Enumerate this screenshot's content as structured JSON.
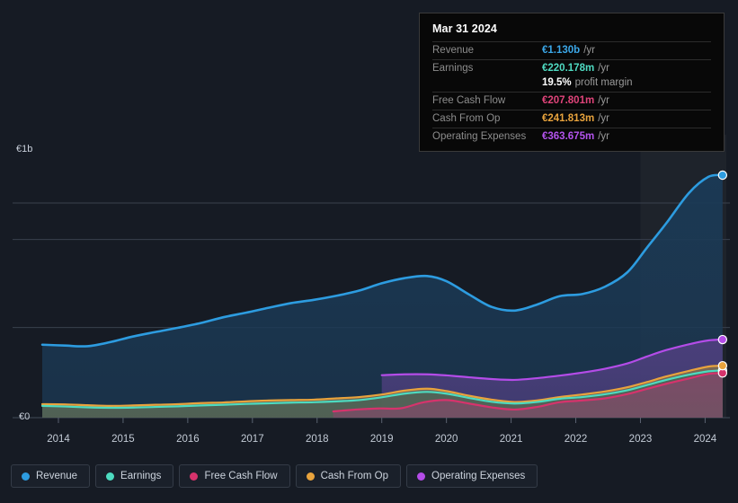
{
  "tooltip": {
    "title": "Mar 31 2024",
    "rows": [
      {
        "label": "Revenue",
        "value": "€1.130b",
        "suffix": "/yr",
        "color": "#3ba7e8"
      },
      {
        "label": "Earnings",
        "value": "€220.178m",
        "suffix": "/yr",
        "color": "#4fdbc2"
      },
      {
        "label": "",
        "value": "19.5%",
        "suffix": "profit margin",
        "color": "#ffffff"
      },
      {
        "label": "Free Cash Flow",
        "value": "€207.801m",
        "suffix": "/yr",
        "color": "#e0447a"
      },
      {
        "label": "Cash From Op",
        "value": "€241.813m",
        "suffix": "/yr",
        "color": "#e8a33d"
      },
      {
        "label": "Operating Expenses",
        "value": "€363.675m",
        "suffix": "/yr",
        "color": "#b454ee"
      }
    ]
  },
  "legend": [
    {
      "label": "Revenue",
      "color": "#2d9ce0"
    },
    {
      "label": "Earnings",
      "color": "#4ddbc0"
    },
    {
      "label": "Free Cash Flow",
      "color": "#d6336c"
    },
    {
      "label": "Cash From Op",
      "color": "#e8a33d"
    },
    {
      "label": "Operating Expenses",
      "color": "#b44ce8"
    }
  ],
  "chart_data": {
    "type": "area",
    "title": "",
    "xlabel": "",
    "ylabel": "",
    "ylim": [
      0,
      1150
    ],
    "y_unit": "EUR",
    "y_ticks": [
      {
        "label": "€1b",
        "value": 1000
      },
      {
        "label": "€0",
        "value": 0
      }
    ],
    "gridlines": [
      1000,
      830,
      420
    ],
    "x_ticks": [
      "2014",
      "2015",
      "2016",
      "2017",
      "2018",
      "2019",
      "2020",
      "2021",
      "2022",
      "2023",
      "2024"
    ],
    "x_range": [
      2013.75,
      2024.3
    ],
    "forecast_start": "2023.0",
    "series": [
      {
        "name": "Revenue",
        "color": "#2d9ce0",
        "fill": "#1b3a56",
        "x": [
          2013.75,
          2014.1,
          2014.45,
          2014.8,
          2015.15,
          2015.5,
          2015.85,
          2016.2,
          2016.55,
          2016.9,
          2017.25,
          2017.6,
          2017.95,
          2018.3,
          2018.65,
          2019.0,
          2019.35,
          2019.7,
          2020.0,
          2020.35,
          2020.7,
          2021.05,
          2021.4,
          2021.75,
          2022.1,
          2022.45,
          2022.8,
          2023.1,
          2023.4,
          2023.75,
          2024.05,
          2024.27
        ],
        "values": [
          340,
          336,
          333,
          352,
          378,
          399,
          419,
          441,
          468,
          489,
          512,
          534,
          549,
          568,
          592,
          626,
          650,
          660,
          636,
          574,
          516,
          499,
          527,
          566,
          576,
          610,
          678,
          792,
          906,
          1047,
          1122,
          1130
        ]
      },
      {
        "name": "Earnings",
        "color": "#4ddbc0",
        "fill": "#4a6357",
        "x": [
          2013.75,
          2014.1,
          2014.45,
          2014.8,
          2015.15,
          2015.5,
          2015.85,
          2016.2,
          2016.55,
          2016.9,
          2017.25,
          2017.6,
          2017.95,
          2018.3,
          2018.65,
          2019.0,
          2019.35,
          2019.7,
          2020.0,
          2020.35,
          2020.7,
          2021.05,
          2021.4,
          2021.75,
          2022.1,
          2022.45,
          2022.8,
          2023.1,
          2023.4,
          2023.75,
          2024.05,
          2024.27
        ],
        "values": [
          55,
          52,
          48,
          46,
          47,
          50,
          53,
          57,
          60,
          64,
          67,
          70,
          72,
          76,
          82,
          95,
          112,
          120,
          112,
          92,
          74,
          66,
          73,
          88,
          96,
          109,
          128,
          152,
          176,
          200,
          216,
          220
        ]
      },
      {
        "name": "Free Cash Flow",
        "color": "#d6336c",
        "fill": "#7e4a68",
        "x": [
          2018.25,
          2018.6,
          2018.95,
          2019.3,
          2019.65,
          2020.0,
          2020.35,
          2020.7,
          2021.05,
          2021.4,
          2021.75,
          2022.1,
          2022.45,
          2022.8,
          2023.1,
          2023.4,
          2023.75,
          2024.05,
          2024.27
        ],
        "values": [
          29,
          38,
          43,
          44,
          72,
          82,
          66,
          48,
          38,
          50,
          72,
          80,
          90,
          110,
          134,
          158,
          183,
          204,
          208
        ]
      },
      {
        "name": "Cash From Op",
        "color": "#e8a33d",
        "fill": "#7d6a50",
        "x": [
          2013.75,
          2014.1,
          2014.45,
          2014.8,
          2015.15,
          2015.5,
          2015.85,
          2016.2,
          2016.55,
          2016.9,
          2017.25,
          2017.6,
          2017.95,
          2018.3,
          2018.65,
          2019.0,
          2019.35,
          2019.7,
          2020.0,
          2020.35,
          2020.7,
          2021.05,
          2021.4,
          2021.75,
          2022.1,
          2022.45,
          2022.8,
          2023.1,
          2023.4,
          2023.75,
          2024.05,
          2024.27
        ],
        "values": [
          63,
          62,
          58,
          55,
          57,
          60,
          63,
          68,
          71,
          76,
          80,
          82,
          84,
          90,
          96,
          108,
          126,
          135,
          124,
          102,
          84,
          73,
          80,
          96,
          108,
          122,
          142,
          166,
          192,
          218,
          238,
          242
        ]
      },
      {
        "name": "Operating Expenses",
        "color": "#b44ce8",
        "fill": "#4d3f7d",
        "x": [
          2019.0,
          2019.35,
          2019.7,
          2020.0,
          2020.35,
          2020.7,
          2021.05,
          2021.4,
          2021.75,
          2022.1,
          2022.45,
          2022.8,
          2023.1,
          2023.4,
          2023.75,
          2024.05,
          2024.27
        ],
        "values": [
          198,
          202,
          202,
          197,
          188,
          180,
          176,
          184,
          196,
          210,
          228,
          253,
          285,
          315,
          342,
          360,
          364
        ]
      }
    ]
  }
}
